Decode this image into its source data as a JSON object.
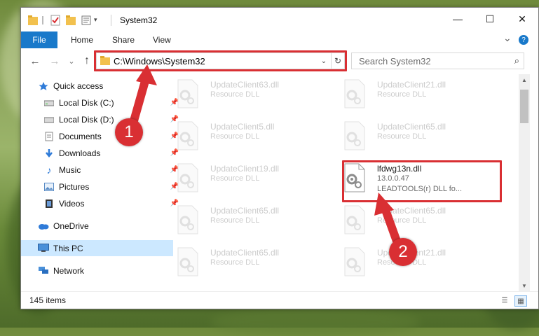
{
  "window": {
    "title": "System32",
    "quick_access_icons": [
      "folder-icon",
      "checkmark-doc-icon",
      "folder-icon",
      "properties-icon",
      "dropdown-icon"
    ],
    "controls": {
      "minimize": "—",
      "maximize": "☐",
      "close": "✕"
    }
  },
  "ribbon": {
    "tabs": [
      "File",
      "Home",
      "Share",
      "View"
    ],
    "expand_glyph": "⌄",
    "help_glyph": "?"
  },
  "navigation": {
    "back": "←",
    "forward": "→",
    "recent": "⌄",
    "up": "↑",
    "address": "C:\\Windows\\System32",
    "address_dropdown": "⌄",
    "refresh": "↻",
    "search_placeholder": "Search System32",
    "search_glyph": "⌕"
  },
  "sidebar": {
    "items": [
      {
        "label": "Quick access",
        "icon": "star-icon",
        "pinned": false
      },
      {
        "label": "Local Disk (C:)",
        "icon": "drive-icon",
        "pinned": true
      },
      {
        "label": "Local Disk (D:)",
        "icon": "drive-icon",
        "pinned": true
      },
      {
        "label": "Documents",
        "icon": "documents-icon",
        "pinned": true
      },
      {
        "label": "Downloads",
        "icon": "download-icon",
        "pinned": true
      },
      {
        "label": "Music",
        "icon": "music-icon",
        "pinned": true
      },
      {
        "label": "Pictures",
        "icon": "pictures-icon",
        "pinned": true
      },
      {
        "label": "Videos",
        "icon": "videos-icon",
        "pinned": true
      },
      {
        "label": "OneDrive",
        "icon": "cloud-icon",
        "pinned": false
      },
      {
        "label": "This PC",
        "icon": "computer-icon",
        "pinned": false,
        "selected": true
      },
      {
        "label": "Network",
        "icon": "network-icon",
        "pinned": false
      }
    ],
    "pin_glyph": "📌"
  },
  "files": [
    {
      "name": "UpdateClient63.dll",
      "desc": "Resource DLL"
    },
    {
      "name": "UpdateClient21.dll",
      "desc": "Resource DLL"
    },
    {
      "name": "UpdateClient5.dll",
      "desc": "Resource DLL"
    },
    {
      "name": "UpdateClient65.dll",
      "desc": "Resource DLL"
    },
    {
      "name": "UpdateClient19.dll",
      "desc": "Resource DLL"
    },
    {
      "name": "lfdwg13n.dll",
      "version": "13.0.0.47",
      "desc": "LEADTOOLS(r) DLL fo...",
      "active": true
    },
    {
      "name": "UpdateClient65.dll",
      "desc": "Resource DLL"
    },
    {
      "name": "UpdateClient65.dll",
      "desc": "Resource DLL"
    },
    {
      "name": "UpdateClient65.dll",
      "desc": "Resource DLL"
    },
    {
      "name": "UpdateClient21.dll",
      "desc": "Resource DLL"
    }
  ],
  "status": {
    "item_count": "145 items",
    "details_view_glyph": "☰",
    "tiles_view_glyph": "▦"
  },
  "annotations": {
    "step1": "1",
    "step2": "2"
  },
  "colors": {
    "accent": "#1979ca",
    "highlight": "#d92f33",
    "selected": "#cce8ff"
  }
}
